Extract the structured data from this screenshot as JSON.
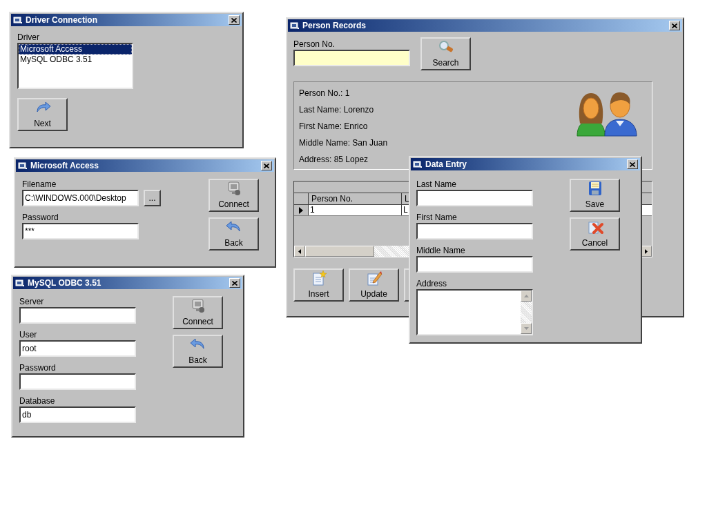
{
  "windows": [
    {
      "kind": "form",
      "title": "Driver Connection",
      "fields": [
        {
          "kind": "list",
          "label": "Driver",
          "items": [
            {
              "label": "Microsoft Access",
              "selected": true
            },
            {
              "label": "MySQL ODBC 3.51",
              "selected": false
            }
          ]
        }
      ],
      "buttons": [
        {
          "kind": "next",
          "label": "Next"
        }
      ]
    },
    {
      "kind": "form",
      "title": "Microsoft Access",
      "fields": [
        {
          "kind": "text",
          "label": "Filename",
          "value": "C:\\WINDOWS.000\\Desktop",
          "browse": "..."
        },
        {
          "kind": "text",
          "label": "Password",
          "value": "***"
        }
      ],
      "buttons": [
        {
          "kind": "connect",
          "label": "Connect"
        },
        {
          "kind": "back",
          "label": "Back"
        }
      ]
    },
    {
      "kind": "form",
      "title": "MySQL ODBC 3.51",
      "fields": [
        {
          "kind": "text",
          "label": "Server"
        },
        {
          "kind": "text",
          "label": "User",
          "value": "root"
        },
        {
          "kind": "text",
          "label": "Password"
        },
        {
          "kind": "text",
          "label": "Database",
          "value": "db"
        }
      ],
      "buttons": [
        {
          "kind": "connect",
          "label": "Connect"
        },
        {
          "kind": "back",
          "label": "Back"
        }
      ]
    },
    {
      "kind": "records",
      "title": "Person Records",
      "search": {
        "label": "Person No.",
        "button": {
          "kind": "search",
          "label": "Search"
        }
      },
      "details": [
        "Person No.: 1",
        "Last Name: Lorenzo",
        "First Name: Enrico",
        "Middle Name: San Juan",
        "Address: 85 Lopez"
      ],
      "grid": {
        "columns": [
          "Person No.",
          "L"
        ],
        "rows": [
          {
            "selected": true,
            "cells": [
              "1",
              "L"
            ]
          }
        ]
      },
      "buttons": [
        {
          "kind": "insert",
          "label": "Insert"
        },
        {
          "kind": "update",
          "label": "Update"
        }
      ]
    },
    {
      "kind": "form",
      "title": "Data Entry",
      "fields": [
        {
          "kind": "text",
          "label": "Last Name"
        },
        {
          "kind": "text",
          "label": "First Name"
        },
        {
          "kind": "text",
          "label": "Middle Name"
        },
        {
          "kind": "textarea",
          "label": "Address"
        }
      ],
      "buttons": [
        {
          "kind": "save",
          "label": "Save"
        },
        {
          "kind": "cancel",
          "label": "Cancel"
        }
      ]
    }
  ]
}
